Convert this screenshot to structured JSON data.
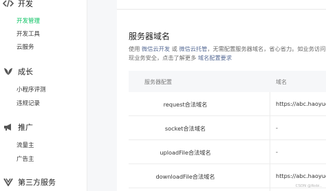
{
  "sidebar": {
    "dev": {
      "title": "开发",
      "icon": "code-icon",
      "items": [
        {
          "label": "开发管理",
          "active": true
        },
        {
          "label": "开发工具",
          "active": false
        },
        {
          "label": "云服务",
          "active": false
        }
      ]
    },
    "grow": {
      "title": "成长",
      "icon": "leaf-icon",
      "items": [
        {
          "label": "小程序评测"
        },
        {
          "label": "违规记录"
        }
      ]
    },
    "promo": {
      "title": "推广",
      "icon": "megaphone-icon",
      "items": [
        {
          "label": "流量主"
        },
        {
          "label": "广告主"
        }
      ]
    },
    "third": {
      "title": "第三方服务",
      "icon": "third-party-icon"
    }
  },
  "section": {
    "title": "服务器域名",
    "desc_line1_prefix": "使用",
    "desc_link1": "微信云开发",
    "desc_or": "或",
    "desc_link2": "微信云托管",
    "desc_line1_suffix": "，无需配置服务器域名，省心省力。如业务访问要",
    "desc_line2": "现业务安全，点击了解更多",
    "desc_link3": "域名配置要求"
  },
  "table": {
    "headers": [
      "服务器配置",
      "域名"
    ],
    "rows": [
      {
        "name": "request合法域名",
        "value": "https://abc.haoyuex"
      },
      {
        "name": "socket合法域名",
        "value": "-"
      },
      {
        "name": "uploadFile合法域名",
        "value": "-"
      },
      {
        "name": "downloadFile合法域名",
        "value": "https://abc.haoyuex"
      }
    ]
  },
  "watermark": "CSDN @Robi..",
  "colors": {
    "accent": "#07c160",
    "link": "#576b95"
  }
}
